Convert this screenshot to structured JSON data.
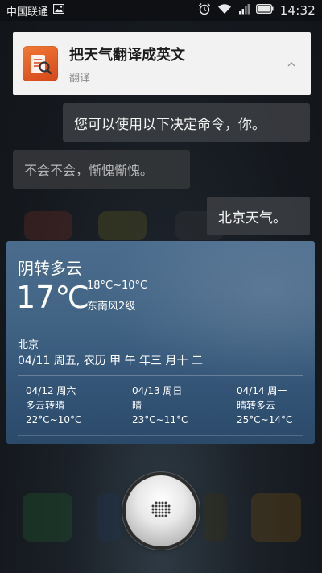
{
  "status_bar": {
    "carrier": "中国联通",
    "time": "14:32",
    "icons": [
      "image-icon",
      "alarm-icon",
      "wifi-icon",
      "signal-icon",
      "battery-icon"
    ]
  },
  "notification": {
    "title": "把天气翻译成英文",
    "subtitle": "翻译",
    "icon": "translate-app-icon"
  },
  "conversation": [
    {
      "from": "user",
      "text": "您可以使用以下决定命令，你。"
    },
    {
      "from": "assistant",
      "text": "不会不会，惭愧惭愧。"
    },
    {
      "from": "user",
      "text": "北京天气。"
    }
  ],
  "weather": {
    "condition": "阴转多云",
    "temperature": "17℃",
    "range": "18°C~10°C",
    "wind": "东南风2级",
    "city": "北京",
    "date": "04/11 周五, 农历 甲 午 年三 月十 二",
    "forecast": [
      {
        "date": "04/12 周六",
        "condition": "多云转晴",
        "range": "22°C~10°C"
      },
      {
        "date": "04/13 周日",
        "condition": "晴",
        "range": "23°C~11°C"
      },
      {
        "date": "04/14 周一",
        "condition": "晴转多云",
        "range": "25°C~14°C"
      }
    ]
  },
  "voice_button": {
    "icon": "microphone-icon"
  }
}
